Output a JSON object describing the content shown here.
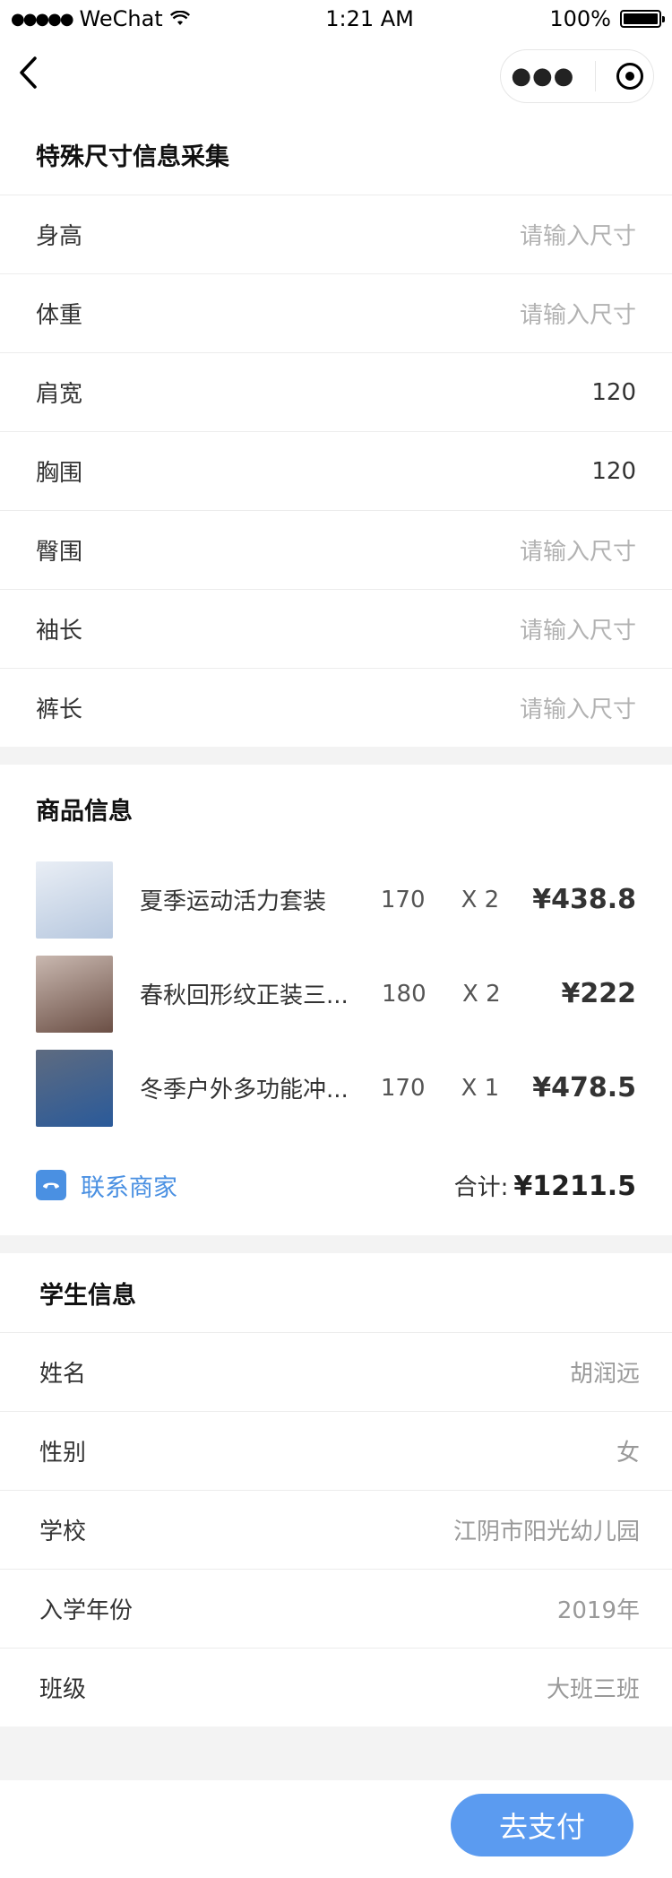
{
  "status_bar": {
    "carrier": "WeChat",
    "time": "1:21 AM",
    "battery": "100%"
  },
  "size_section": {
    "title": "特殊尺寸信息采集",
    "rows": [
      {
        "label": "身高",
        "value": "请输入尺寸",
        "placeholder": true
      },
      {
        "label": "体重",
        "value": "请输入尺寸",
        "placeholder": true
      },
      {
        "label": "肩宽",
        "value": "120",
        "placeholder": false
      },
      {
        "label": "胸围",
        "value": "120",
        "placeholder": false
      },
      {
        "label": "臀围",
        "value": "请输入尺寸",
        "placeholder": true
      },
      {
        "label": "袖长",
        "value": "请输入尺寸",
        "placeholder": true
      },
      {
        "label": "裤长",
        "value": "请输入尺寸",
        "placeholder": true
      }
    ]
  },
  "goods_section": {
    "title": "商品信息",
    "items": [
      {
        "name": "夏季运动活力套装",
        "size": "170",
        "qty": "X 2",
        "price": "¥438.8",
        "thumb_colors": [
          "#e9eef5",
          "#b7c8df"
        ]
      },
      {
        "name": "春秋回形纹正装三...",
        "size": "180",
        "qty": "X 2",
        "price": "¥222",
        "thumb_colors": [
          "#c9b8b0",
          "#6b4f45"
        ]
      },
      {
        "name": "冬季户外多功能冲...",
        "size": "170",
        "qty": "X 1",
        "price": "¥478.5",
        "thumb_colors": [
          "#5e6b80",
          "#2a5a9a"
        ]
      }
    ],
    "contact_label": "联系商家",
    "total_label": "合计:",
    "total_amount": "¥1211.5"
  },
  "student_section": {
    "title": "学生信息",
    "rows": [
      {
        "label": "姓名",
        "value": "胡润远"
      },
      {
        "label": "性别",
        "value": "女"
      },
      {
        "label": "学校",
        "value": "江阴市阳光幼儿园"
      },
      {
        "label": "入学年份",
        "value": "2019年"
      },
      {
        "label": "班级",
        "value": "大班三班"
      }
    ]
  },
  "footer": {
    "pay_label": "去支付"
  },
  "colors": {
    "accent": "#4a90e2",
    "pay_button": "#5b9bf0",
    "placeholder": "#b2b2b2"
  }
}
